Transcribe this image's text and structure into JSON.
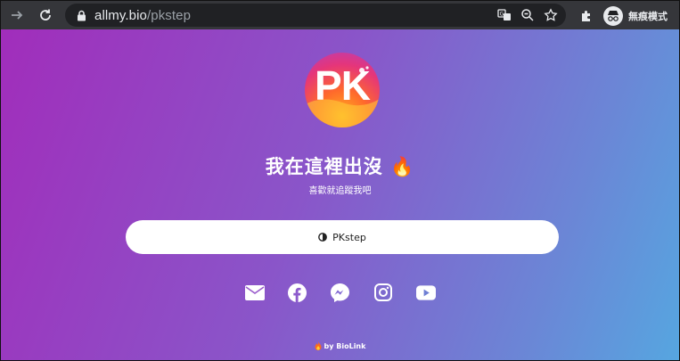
{
  "browser": {
    "url_host": "allmy.bio",
    "url_path": "/pkstep",
    "incognito_label": "無痕模式"
  },
  "profile": {
    "avatar_text": "PK",
    "title": "我在這裡出沒",
    "title_emoji": "🔥",
    "subtitle": "喜歡就追蹤我吧"
  },
  "links": [
    {
      "label": "PKstep",
      "icon": "half-circle-icon"
    }
  ],
  "socials": [
    "email-icon",
    "facebook-icon",
    "messenger-icon",
    "instagram-icon",
    "youtube-icon"
  ],
  "footer": {
    "icon": "flame-icon",
    "text": "by BioLink"
  },
  "colors": {
    "gradient_start": "#a12dbb",
    "gradient_end": "#56a6e0",
    "toolbar": "#35363a",
    "omnibox": "#202124"
  }
}
